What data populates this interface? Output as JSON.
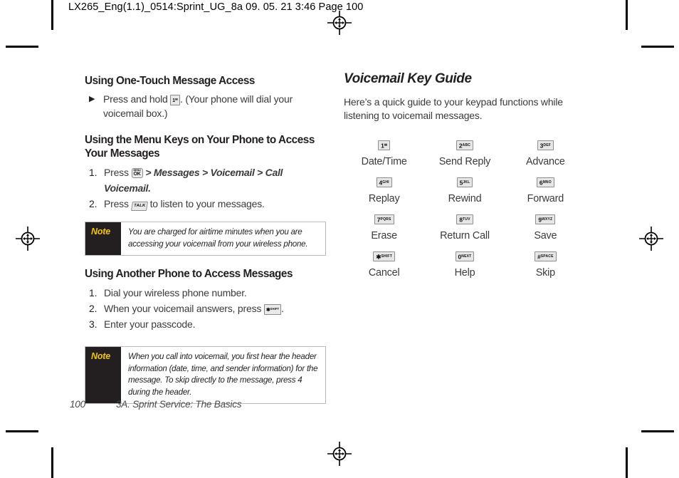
{
  "slug": "LX265_Eng(1.1)_0514:Sprint_UG_8a  09. 05. 21    3:46  Page 100",
  "left_column": {
    "section1_heading": "Using One-Touch Message Access",
    "section1_bullet": {
      "marker": "▶",
      "text_before_key": "Press and hold",
      "key": {
        "digit": "1",
        "letters": "✉"
      },
      "text_after_key": ". (Your phone will dial your voicemail box.)"
    },
    "section2_heading": "Using the Menu Keys on Your Phone to Access Your Messages",
    "section2_steps": [
      {
        "num": "1.",
        "text_before_key": "Press",
        "key_label": "OK",
        "key_top_label": "MENU",
        "path": "> Messages > Voicemail > Call Voicemail."
      },
      {
        "num": "2.",
        "text_before_key": "Press",
        "key_label": "TALK",
        "text_after_key": "to listen to your messages."
      }
    ],
    "note1": {
      "label": "Note",
      "text": "You are charged for airtime minutes when you are accessing your voicemail from your wireless phone."
    },
    "section3_heading": "Using Another Phone to Access Messages",
    "section3_steps": [
      {
        "num": "1.",
        "text": "Dial your wireless phone number."
      },
      {
        "num": "2.",
        "text_before_key": "When your voicemail answers, press",
        "key": {
          "digit": "✱",
          "letters": "SHIFT"
        },
        "text_after_key": "."
      },
      {
        "num": "3.",
        "text": "Enter your passcode."
      }
    ],
    "note2": {
      "label": "Note",
      "text": "When you call into voicemail, you first hear the header information (date, time, and sender information) for the message. To skip directly to the message, press 4 during the header."
    }
  },
  "right_column": {
    "title": "Voicemail Key Guide",
    "intro": "Here’s a quick guide to your keypad functions while listening to voicemail messages.",
    "keys": [
      {
        "digit": "1",
        "letters": "✉",
        "function": "Date/Time"
      },
      {
        "digit": "2",
        "letters": "ABC",
        "function": "Send Reply"
      },
      {
        "digit": "3",
        "letters": "DEF",
        "function": "Advance"
      },
      {
        "digit": "4",
        "letters": "GHI",
        "function": "Replay"
      },
      {
        "digit": "5",
        "letters": "JKL",
        "function": "Rewind"
      },
      {
        "digit": "6",
        "letters": "MNO",
        "function": "Forward"
      },
      {
        "digit": "7",
        "letters": "PQRS",
        "function": "Erase"
      },
      {
        "digit": "8",
        "letters": "TUV",
        "function": "Return Call"
      },
      {
        "digit": "9",
        "letters": "WXYZ",
        "function": "Save"
      },
      {
        "digit": "✱",
        "letters": "SHIFT",
        "function": "Cancel"
      },
      {
        "digit": "0",
        "letters": "NEXT",
        "function": "Help"
      },
      {
        "digit": "#",
        "letters": "SPACE",
        "function": "Skip"
      }
    ]
  },
  "footer": {
    "page_number": "100",
    "section_title": "3A. Sprint Service: The Basics"
  },
  "colors": {
    "note_tab_background": "#231f20",
    "note_label": "#f2c500",
    "body_text": "#3b3b3b",
    "heading_text": "#231f20"
  }
}
